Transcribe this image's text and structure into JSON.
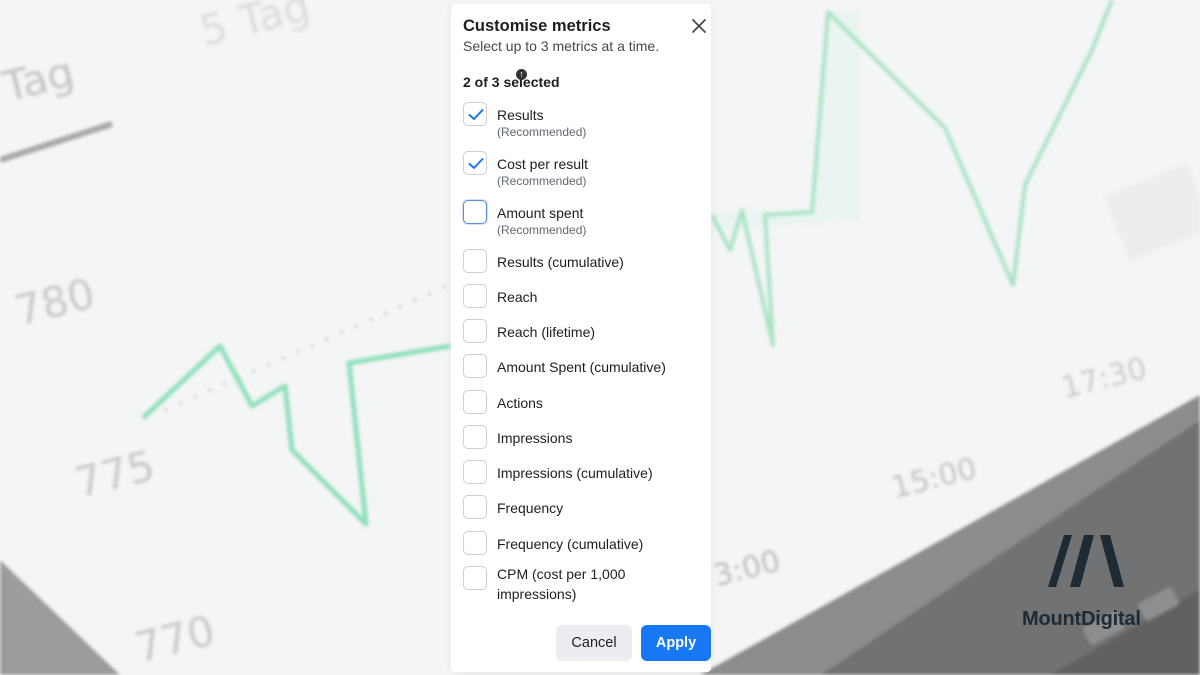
{
  "background": {
    "tags": [
      "5 Tag",
      "Tag"
    ],
    "axis_values": [
      "780",
      "775",
      "770"
    ],
    "time_labels": [
      "3:00",
      "15:00",
      "17:30"
    ],
    "colors": {
      "line": "#7fdcb0",
      "panel": "#f4f5f5",
      "laptop": "#6f7173"
    }
  },
  "dialog": {
    "title": "Customise metrics",
    "subtitle": "Select up to 3 metrics at a time.",
    "selection_count": "2 of 3 selected",
    "close_icon": "close-icon",
    "options": [
      {
        "label": "Results",
        "sub": "(Recommended)",
        "checked": true
      },
      {
        "label": "Cost per result",
        "sub": "(Recommended)",
        "checked": true
      },
      {
        "label": "Amount spent",
        "sub": "(Recommended)",
        "checked": false
      },
      {
        "label": "Results (cumulative)",
        "checked": false
      },
      {
        "label": "Reach",
        "checked": false
      },
      {
        "label": "Reach (lifetime)",
        "checked": false
      },
      {
        "label": "Amount Spent (cumulative)",
        "checked": false
      },
      {
        "label": "Actions",
        "checked": false
      },
      {
        "label": "Impressions",
        "checked": false
      },
      {
        "label": "Impressions (cumulative)",
        "checked": false
      },
      {
        "label": "Frequency",
        "checked": false
      },
      {
        "label": "Frequency (cumulative)",
        "checked": false
      },
      {
        "label": "CPM (cost per 1,000 impressions)",
        "checked": false
      }
    ],
    "cancel_label": "Cancel",
    "apply_label": "Apply",
    "colors": {
      "accent": "#1877f2",
      "check": "#1877f2"
    }
  },
  "logo": {
    "name": "MountDigital",
    "color": "#1f2a33"
  }
}
